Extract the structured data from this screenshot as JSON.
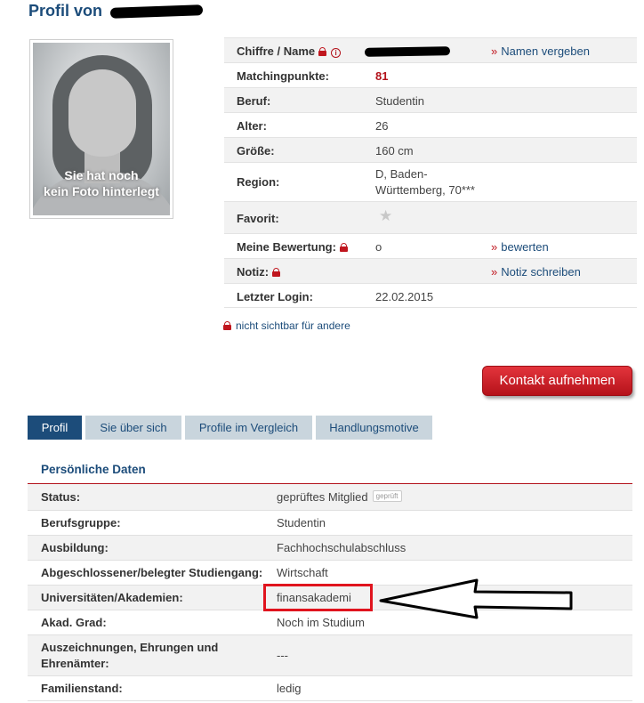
{
  "page": {
    "title": "Profil von"
  },
  "photo": {
    "caption_line1": "Sie hat noch",
    "caption_line2": "kein Foto hinterlegt"
  },
  "profile": {
    "rows": [
      {
        "label": "Chiffre / Name",
        "value": "",
        "action": "Namen vergeben"
      },
      {
        "label": "Matchingpunkte:",
        "value": "81"
      },
      {
        "label": "Beruf:",
        "value": "Studentin"
      },
      {
        "label": "Alter:",
        "value": "26"
      },
      {
        "label": "Größe:",
        "value": "160 cm"
      },
      {
        "label": "Region:",
        "value_line1": "D, Baden-",
        "value_line2": "Württemberg, 70***"
      },
      {
        "label": "Favorit:",
        "icon": "star-icon"
      },
      {
        "label": "Meine Bewertung:",
        "value": "o",
        "action": "bewerten"
      },
      {
        "label": "Notiz:",
        "value": "",
        "action": "Notiz schreiben"
      },
      {
        "label": "Letzter Login:",
        "value": "22.02.2015"
      }
    ],
    "action_marker": "»",
    "privacy_note": "nicht sichtbar für andere"
  },
  "contact_button": "Kontakt aufnehmen",
  "tabs": [
    {
      "label": "Profil",
      "active": true
    },
    {
      "label": "Sie über sich",
      "active": false
    },
    {
      "label": "Profile im Vergleich",
      "active": false
    },
    {
      "label": "Handlungsmotive",
      "active": false
    }
  ],
  "details": {
    "section_title": "Persönliche Daten",
    "rows": [
      {
        "label": "Status:",
        "value": "geprüftes Mitglied",
        "badge": "geprüft"
      },
      {
        "label": "Berufsgruppe:",
        "value": "Studentin"
      },
      {
        "label": "Ausbildung:",
        "value": "Fachhochschulabschluss"
      },
      {
        "label": "Abgeschlossener/belegter Studiengang:",
        "value": "Wirtschaft"
      },
      {
        "label": "Universitäten/Akademien:",
        "value": "finansakademi"
      },
      {
        "label": "Akad. Grad:",
        "value": "Noch im Studium"
      },
      {
        "label_line1": "Auszeichnungen, Ehrungen und",
        "label_line2": "Ehrenämter:",
        "value": "---"
      },
      {
        "label": "Familienstand:",
        "value": "ledig"
      }
    ]
  },
  "colors": {
    "brand_blue": "#1c4c7a",
    "accent_red": "#c0161e",
    "tab_inactive": "#c9d5dd"
  }
}
